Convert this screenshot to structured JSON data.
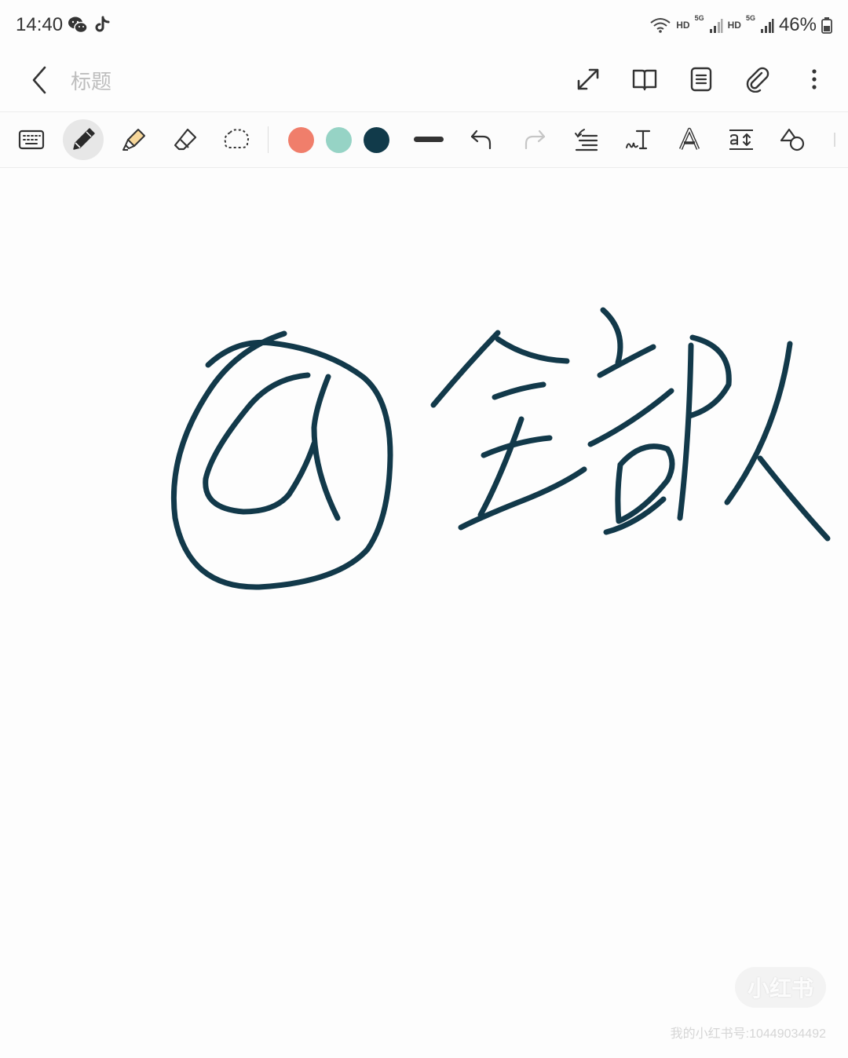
{
  "status_bar": {
    "time": "14:40",
    "left_icons": [
      "wechat-icon",
      "tiktok-icon"
    ],
    "right_icons": [
      "wifi-icon",
      "signal-5g-icon",
      "signal-5g-icon",
      "battery-icon"
    ],
    "hd_labels": [
      "HD",
      "HD"
    ],
    "network_labels": [
      "5G",
      "5G"
    ],
    "battery": "46%"
  },
  "header": {
    "title_placeholder": "标题",
    "actions": [
      "expand-icon",
      "book-view-icon",
      "page-view-icon",
      "attach-icon",
      "more-icon"
    ]
  },
  "toolbar": {
    "tools": [
      "keyboard-icon",
      "pen-icon",
      "highlighter-icon",
      "eraser-icon",
      "lasso-select-icon"
    ],
    "active_tool": "pen-icon",
    "colors": [
      "#f07e6b",
      "#96d3c5",
      "#113a4a"
    ],
    "selected_color": "#113a4a",
    "stroke": "line-thickness-icon",
    "history": [
      "undo-icon",
      "redo-icon"
    ],
    "extra_tools": [
      "straighten-icon",
      "handwriting-to-text-icon",
      "text-style-icon",
      "text-size-icon",
      "shapes-icon"
    ]
  },
  "canvas": {
    "ink_color": "#12394a"
  },
  "watermark": {
    "logo": "小红书",
    "id_text": "我的小红书号:10449034492"
  }
}
